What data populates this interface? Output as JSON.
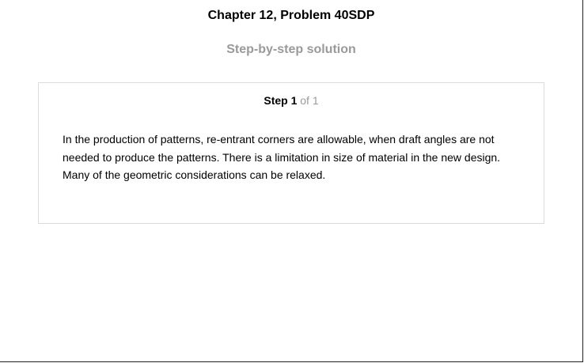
{
  "header": {
    "title": "Chapter 12, Problem 40SDP",
    "subtitle": "Step-by-step solution"
  },
  "step": {
    "label": "Step 1",
    "count": "of 1",
    "text": "In the production of patterns, re-entrant corners are allowable, when draft angles are not needed to produce the patterns. There is a limitation in size of material in the new design. Many of the geometric considerations can be relaxed."
  }
}
